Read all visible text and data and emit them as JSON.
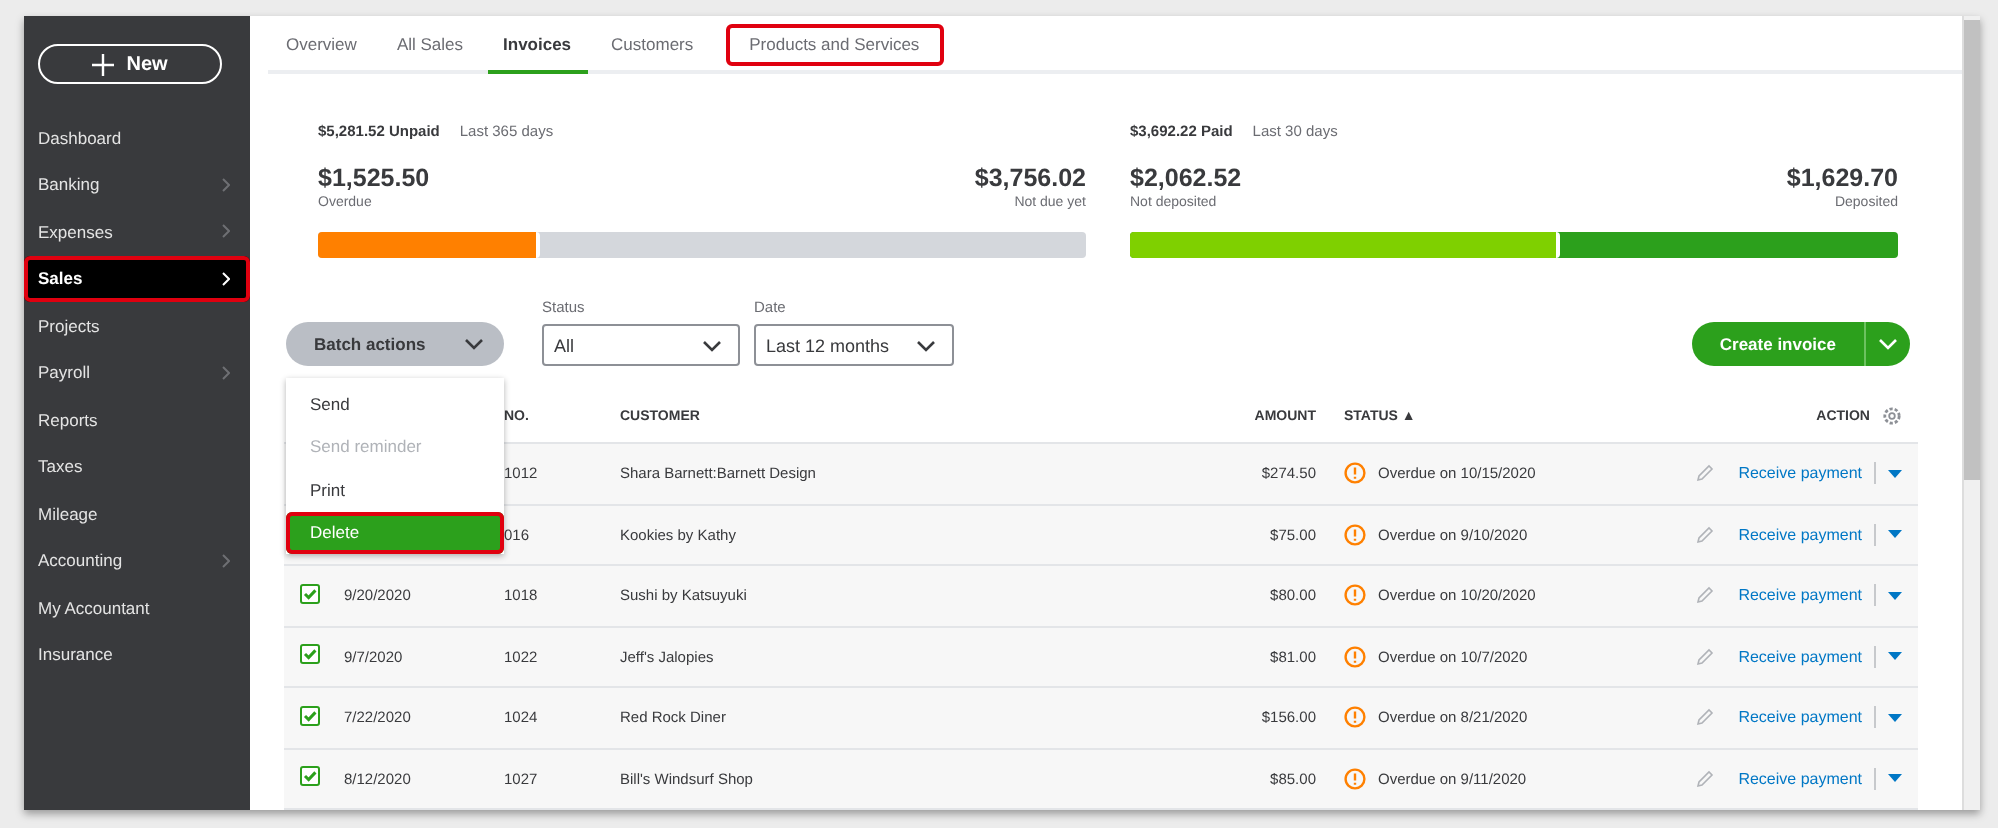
{
  "sidebar": {
    "new_button": {
      "label": "New"
    },
    "items": [
      {
        "label": "Dashboard",
        "has_submenu": false,
        "selected": false,
        "highlighted": false
      },
      {
        "label": "Banking",
        "has_submenu": true,
        "selected": false,
        "highlighted": false
      },
      {
        "label": "Expenses",
        "has_submenu": true,
        "selected": false,
        "highlighted": false
      },
      {
        "label": "Sales",
        "has_submenu": true,
        "selected": true,
        "highlighted": true
      },
      {
        "label": "Projects",
        "has_submenu": false,
        "selected": false,
        "highlighted": false
      },
      {
        "label": "Payroll",
        "has_submenu": true,
        "selected": false,
        "highlighted": false
      },
      {
        "label": "Reports",
        "has_submenu": false,
        "selected": false,
        "highlighted": false
      },
      {
        "label": "Taxes",
        "has_submenu": false,
        "selected": false,
        "highlighted": false
      },
      {
        "label": "Mileage",
        "has_submenu": false,
        "selected": false,
        "highlighted": false
      },
      {
        "label": "Accounting",
        "has_submenu": true,
        "selected": false,
        "highlighted": false
      },
      {
        "label": "My Accountant",
        "has_submenu": false,
        "selected": false,
        "highlighted": false
      },
      {
        "label": "Insurance",
        "has_submenu": false,
        "selected": false,
        "highlighted": false
      }
    ]
  },
  "tabs": [
    {
      "label": "Overview",
      "selected": false,
      "highlighted": false
    },
    {
      "label": "All Sales",
      "selected": false,
      "highlighted": false
    },
    {
      "label": "Invoices",
      "selected": true,
      "highlighted": false
    },
    {
      "label": "Customers",
      "selected": false,
      "highlighted": false
    },
    {
      "label": "Products and Services",
      "selected": false,
      "highlighted": true
    }
  ],
  "summary": [
    {
      "kind": "unpaid",
      "headline": "$5,281.52 Unpaid",
      "period": "Last 365 days",
      "left_amount": "$1,525.50",
      "left_label": "Overdue",
      "right_amount": "$3,756.02",
      "right_label": "Not due yet",
      "level": 0.29
    },
    {
      "kind": "paid",
      "headline": "$3,692.22 Paid",
      "period": "Last 30 days",
      "left_amount": "$2,062.52",
      "left_label": "Not deposited",
      "right_amount": "$1,629.70",
      "right_label": "Deposited",
      "level": 0.56
    }
  ],
  "filters": {
    "batch_button": "Batch actions",
    "status": {
      "label": "Status",
      "value": "All"
    },
    "date": {
      "label": "Date",
      "value": "Last 12 months"
    },
    "create_button": "Create invoice"
  },
  "batch_menu": [
    {
      "label": "Send",
      "disabled": false,
      "selected": false,
      "highlighted": false
    },
    {
      "label": "Send reminder",
      "disabled": true,
      "selected": false,
      "highlighted": false
    },
    {
      "label": "Print",
      "disabled": false,
      "selected": false,
      "highlighted": false
    },
    {
      "label": "Delete",
      "disabled": false,
      "selected": true,
      "highlighted": true
    }
  ],
  "table": {
    "columns": {
      "no": "NO.",
      "customer": "CUSTOMER",
      "amount": "AMOUNT",
      "status": "STATUS",
      "sort_indicator": "▲",
      "action": "ACTION"
    },
    "rows": [
      {
        "no": "1012",
        "customer": "Shara Barnett:Barnett Design",
        "amount": "$274.50",
        "status": "Overdue on 10/15/2020",
        "action": "Receive payment"
      },
      {
        "no": "016",
        "customer": "Kookies by Kathy",
        "amount": "$75.00",
        "status": "Overdue on 9/10/2020",
        "action": "Receive payment"
      },
      {
        "checked": true,
        "date": "9/20/2020",
        "no": "1018",
        "customer": "Sushi by Katsuyuki",
        "amount": "$80.00",
        "status": "Overdue on 10/20/2020",
        "action": "Receive payment"
      },
      {
        "checked": true,
        "date": "9/7/2020",
        "no": "1022",
        "customer": "Jeff's Jalopies",
        "amount": "$81.00",
        "status": "Overdue on 10/7/2020",
        "action": "Receive payment"
      },
      {
        "checked": true,
        "date": "7/22/2020",
        "no": "1024",
        "customer": "Red Rock Diner",
        "amount": "$156.00",
        "status": "Overdue on 8/21/2020",
        "action": "Receive payment"
      },
      {
        "checked": true,
        "date": "8/12/2020",
        "no": "1027",
        "customer": "Bill's Windsurf Shop",
        "amount": "$85.00",
        "status": "Overdue on 9/11/2020",
        "action": "Receive payment"
      }
    ]
  }
}
